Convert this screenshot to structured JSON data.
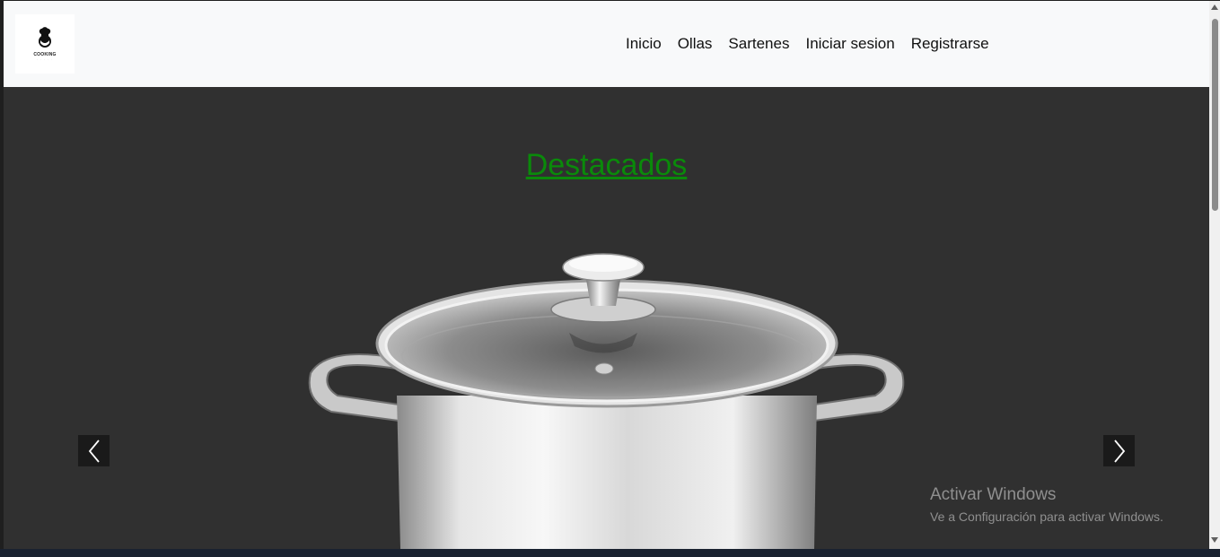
{
  "navbar": {
    "logo": {
      "name": "COOKING",
      "sub": "· · · · ·"
    },
    "links": [
      "Inicio",
      "Ollas",
      "Sartenes",
      "Iniciar sesion",
      "Registrarse"
    ]
  },
  "main": {
    "heading": "Destacados",
    "carousel": {
      "image": "stainless-steel-stock-pot",
      "prev_icon": "chevron-left-icon",
      "next_icon": "chevron-right-icon"
    }
  },
  "watermark": {
    "title": "Activar Windows",
    "subtitle": "Ve a Configuración para activar Windows."
  },
  "colors": {
    "navbar_bg": "#f8f9fa",
    "page_bg": "#303030",
    "heading": "#0a8a0a",
    "control_bg": "#1a1a1a"
  }
}
